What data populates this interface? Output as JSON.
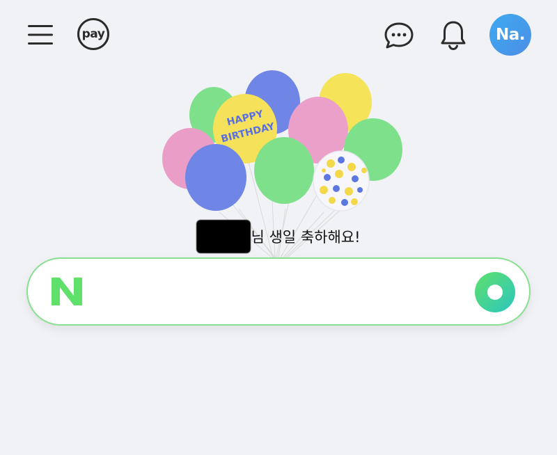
{
  "header": {
    "menu_icon": "hamburger-menu-icon",
    "pay_label": "pay",
    "chat_icon": "chat-bubble-icon",
    "bell_icon": "bell-icon",
    "avatar_label": "Na."
  },
  "illustration": {
    "balloon_text_line1": "HAPPY",
    "balloon_text_line2": "BIRTHDAY"
  },
  "greeting": {
    "visible_prefix": "님",
    "text": " 생일 축하해요!"
  },
  "search": {
    "logo": "N",
    "placeholder": "",
    "value": ""
  },
  "colors": {
    "background": "#f1f2f6",
    "naver_green": "#5ee06a",
    "search_border": "#86e08e",
    "avatar_blue": "#3fa9f0"
  }
}
